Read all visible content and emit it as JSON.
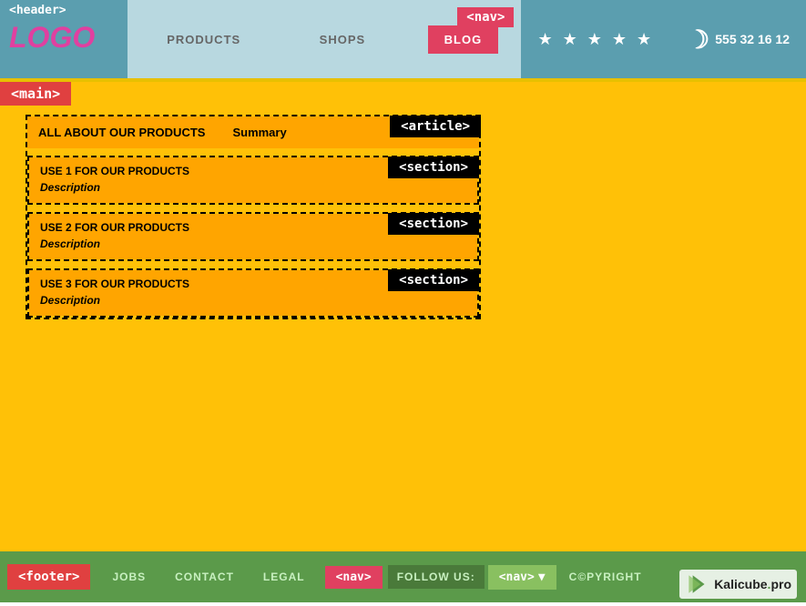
{
  "header": {
    "tag": "<header>",
    "logo": "LOGO",
    "nav_tag": "<nav>",
    "nav_items": [
      {
        "label": "PRODUCTS",
        "active": false
      },
      {
        "label": "SHOPS",
        "active": false
      },
      {
        "label": "BLOG",
        "active": true
      }
    ],
    "stars": "★ ★ ★ ★ ★",
    "moon_icon": "☽",
    "phone": "555 32 16 12"
  },
  "main": {
    "tag": "<main>",
    "article": {
      "tag": "<article>",
      "title": "ALL ABOUT OUR PRODUCTS",
      "summary_label": "Summary"
    },
    "sections": [
      {
        "tag": "<section>",
        "title": "USE 1 FOR OUR PRODUCTS",
        "description": "Description"
      },
      {
        "tag": "<section>",
        "title": "USE 2 FOR OUR PRODUCTS",
        "description": "Description"
      },
      {
        "tag": "<section>",
        "title": "USE 3 FOR OUR PRODUCTS",
        "description": "Description"
      }
    ]
  },
  "footer": {
    "tag": "<footer>",
    "nav_tag": "<nav>",
    "nav_items": [
      {
        "label": "JOBS"
      },
      {
        "label": "CONTACT"
      },
      {
        "label": "LEGAL"
      }
    ],
    "follow_label": "FOLLOW US:",
    "follow_nav_tag": "<nav>",
    "follow_nav_arrow": "▼",
    "copyright": "C©PYRIGHT"
  },
  "brand": {
    "name": "Kalicube",
    "dot": ".",
    "suffix": "pro"
  }
}
